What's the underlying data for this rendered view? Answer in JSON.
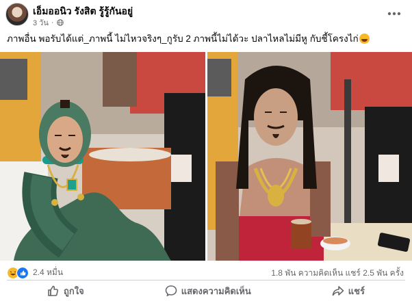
{
  "header": {
    "author": "เอ็มออนิว รังสิต รู้รู้กันอยู่",
    "time": "3 วัน",
    "more_label": "⋯",
    "close_label": "✕"
  },
  "caption": {
    "text": "ภาพอื่น  พอรับได้แต่_ภาพนี้  ไม่ไหวจริงๆ_กูรับ 2 ภาพนี้ไม่ได้วะ ปลาไหลไม่มีหู กับชี้โครงไก่"
  },
  "photos": [
    {
      "label": "snake-costume-photo"
    },
    {
      "label": "dreadlocks-photo"
    }
  ],
  "stats": {
    "reactions_count": "2.4 หมื่น",
    "comments_shares": "1.8 พัน ความคิดเห็น  แชร์ 2.5 พัน ครั้ง"
  },
  "actions": {
    "like": "ถูกใจ",
    "comment": "แสดงความคิดเห็น",
    "share": "แชร์"
  },
  "colors": {
    "like_blue": "#1877f2",
    "haha_yellow": "#f7b928",
    "secondary_text": "#65676b"
  }
}
